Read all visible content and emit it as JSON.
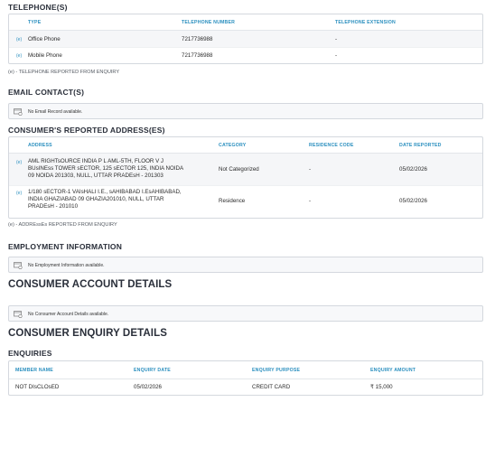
{
  "telephone": {
    "title": "TELEPHONE(S)",
    "headers": [
      "TYPE",
      "TELEPHONE NUMBER",
      "TELEPHONE EXTENSION"
    ],
    "rows": [
      {
        "mark": "(e)",
        "type": "Office Phone",
        "number": "7217736988",
        "ext": "-"
      },
      {
        "mark": "(e)",
        "type": "Mobile Phone",
        "number": "7217736988",
        "ext": "-"
      }
    ],
    "note": "(e) - TELEPHONE REPORTED FROM ENQUIRY"
  },
  "email": {
    "title": "EMAIL CONTACT(S)",
    "empty_text": "No Email Record available."
  },
  "address": {
    "title": "CONSUMER'S REPORTED ADDRESS(ES)",
    "headers": [
      "ADDRESS",
      "CATEGORY",
      "RESIDENCE CODE",
      "DATE REPORTED"
    ],
    "rows": [
      {
        "mark": "(e)",
        "address_lines": [
          "AML RIGHTsOURCE INDIA P L AML-5TH, FLOOR V J",
          "BUsINEss TOWER sECTOR, 125 sECTOR 125, INDIA NOIDA",
          "09 NOIDA 201303, NULL, UTTAR PRADEsH - 201303"
        ],
        "category": "Not Categorized",
        "residence_code": "-",
        "date": "05/02/2026"
      },
      {
        "mark": "(e)",
        "address_lines": [
          "1/180 sECTOR-1 VAIsHALI I.E., sAHIBABAD I.EsAHIBABAD,",
          "INDIA GHAZIABAD 09 GHAZIA201010, NULL, UTTAR",
          "PRADEsH - 201010"
        ],
        "category": "Residence",
        "residence_code": "-",
        "date": "05/02/2026"
      }
    ],
    "note": "(e) - ADDREssEs REPORTED FROM ENQUIRY"
  },
  "employment": {
    "title": "EMPLOYMENT INFORMATION",
    "empty_text": "No Employment Information available."
  },
  "account": {
    "title": "CONSUMER ACCOUNT DETAILS",
    "empty_text": "No Consumer Account Details available."
  },
  "enquiry_details": {
    "title": "CONSUMER ENQUIRY DETAILS"
  },
  "enquiries": {
    "title": "ENQUIRIES",
    "headers": [
      "MEMBER NAME",
      "ENQUIRY DATE",
      "ENQUIRY PURPOSE",
      "ENQUIRY AMOUNT"
    ],
    "rows": [
      {
        "member": "NOT DIsCLOsED",
        "date": "05/02/2026",
        "purpose": "CREDIT CARD",
        "amount": "₹ 15,000"
      }
    ]
  }
}
